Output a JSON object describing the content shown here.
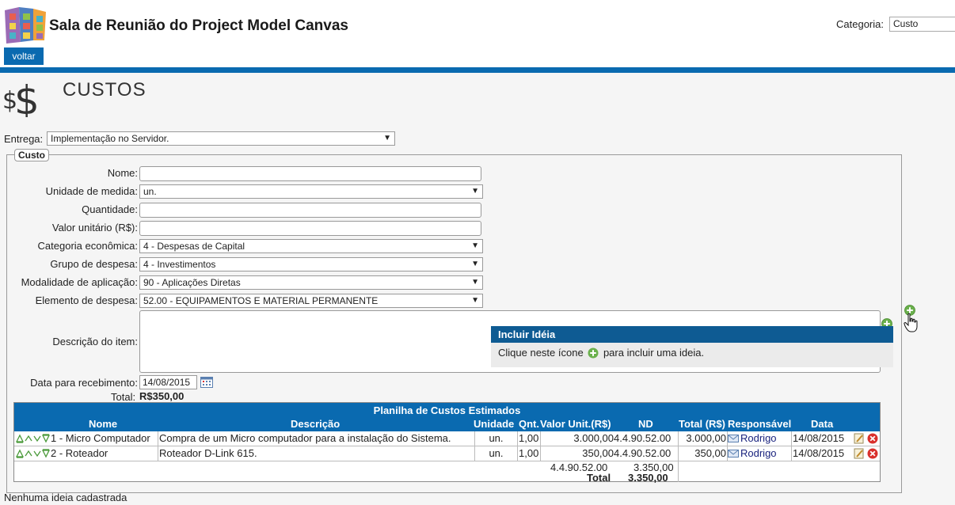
{
  "header": {
    "app_title": "Sala de Reunião do Project Model Canvas",
    "categoria_label": "Categoria:",
    "categoria_value": "Custo",
    "back_label": "voltar"
  },
  "section": {
    "title": "CUSTOS",
    "icon": "dollar-icon"
  },
  "entrega": {
    "label": "Entrega:",
    "value": "Implementação no Servidor."
  },
  "form": {
    "legend": "Custo",
    "nome_label": "Nome:",
    "unidade_label": "Unidade de medida:",
    "unidade_value": "un.",
    "quantidade_label": "Quantidade:",
    "valor_label": "Valor unitário (R$):",
    "categoria_label": "Categoria econômica:",
    "categoria_value": "4 - Despesas de Capital",
    "grupo_label": "Grupo de despesa:",
    "grupo_value": "4 - Investimentos",
    "modalidade_label": "Modalidade de aplicação:",
    "modalidade_value": "90 - Aplicações Diretas",
    "elemento_label": "Elemento de despesa:",
    "elemento_value": "52.00 - EQUIPAMENTOS E MATERIAL PERMANENTE",
    "descricao_label": "Descrição do item:",
    "data_label": "Data para recebimento:",
    "data_value": "14/08/2015",
    "total_label": "Total:",
    "total_value": "R$350,00"
  },
  "tooltip": {
    "title": "Incluir Idéia",
    "text_before": "Clique neste ícone",
    "text_after": "para incluir uma ideia."
  },
  "table": {
    "title": "Planilha de Custos Estimados",
    "headers": [
      "Nome",
      "Descrição",
      "Unidade",
      "Qnt.",
      "Valor Unit.(R$)",
      "ND",
      "Total (R$)",
      "Responsável",
      "Data"
    ],
    "rows": [
      {
        "nome": "1 - Micro Computador",
        "descricao": "Compra de um Micro computador para a instalação do Sistema.",
        "unidade": "un.",
        "qnt": "1,00",
        "valor": "3.000,00",
        "nd": "4.4.90.52.00",
        "total": "3.000,00",
        "responsavel": "Rodrigo",
        "data": "14/08/2015"
      },
      {
        "nome": "2 - Roteador",
        "descricao": "Roteador D-Link 615.",
        "unidade": "un.",
        "qnt": "1,00",
        "valor": "350,00",
        "nd": "4.4.90.52.00",
        "total": "350,00",
        "responsavel": "Rodrigo",
        "data": "14/08/2015"
      }
    ],
    "summary_nd": "4.4.90.52.00",
    "summary_nd_value": "3.350,00",
    "total_label": "Total",
    "total_value": "3.350,00"
  },
  "footer": {
    "no_ideas": "Nenhuma ideia cadastrada"
  },
  "colors": {
    "brand_blue": "#0a6ab0",
    "tooltip_blue": "#0e5b93",
    "plus_green": "#6ab04c",
    "delete_red": "#d9302c"
  }
}
